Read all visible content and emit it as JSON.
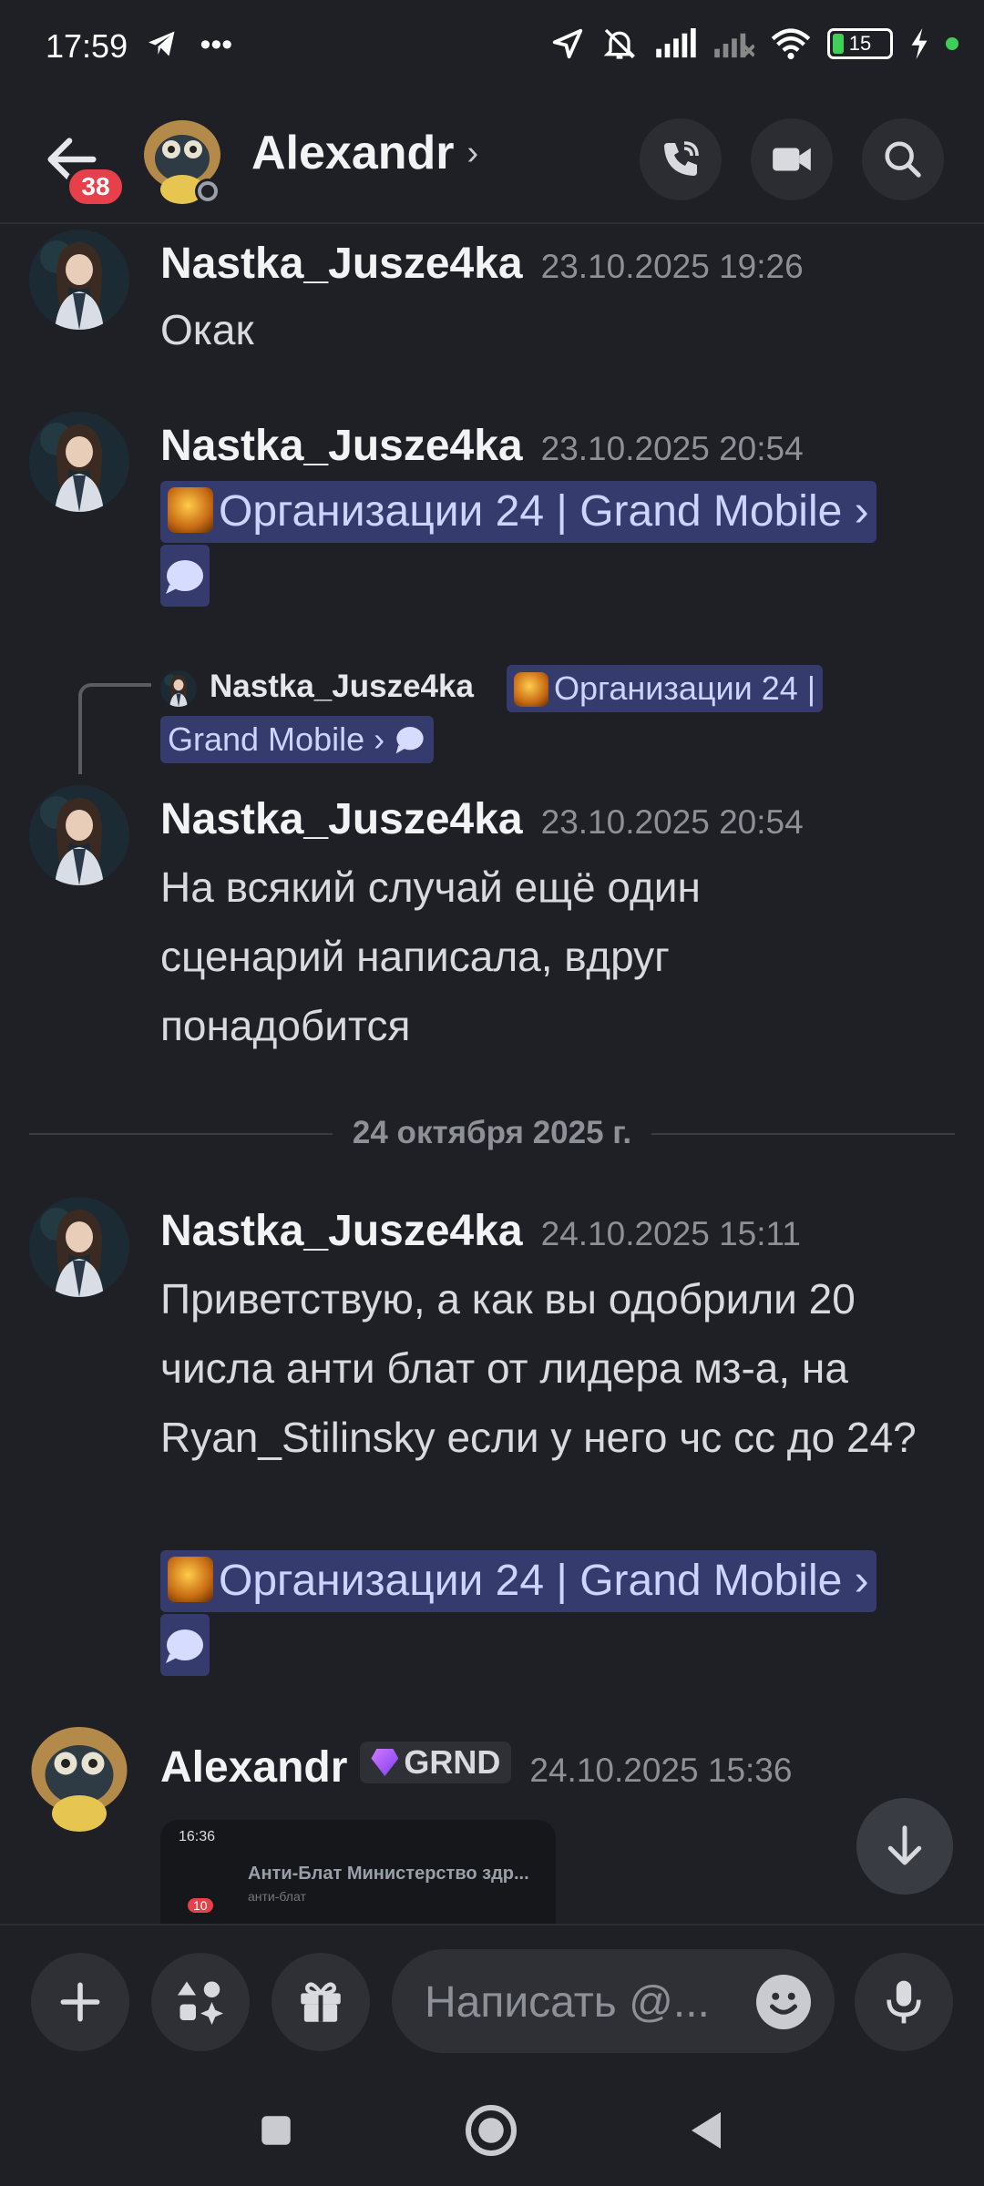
{
  "status_bar": {
    "time": "17:59",
    "left_icons": [
      "telegram-icon",
      "more-icon"
    ],
    "battery": "15",
    "right_icons": [
      "location-icon",
      "mute-icon",
      "signal-icon",
      "signal-2-icon",
      "wifi-icon",
      "battery-icon",
      "charging-icon"
    ]
  },
  "header": {
    "title": "Alexandr",
    "unread_badge": "38",
    "actions": [
      "call-icon",
      "video-icon",
      "search-icon"
    ]
  },
  "messages": [
    {
      "author": "Nastka_Jusze4ka",
      "timestamp": "23.10.2025 19:26",
      "text": "Окак"
    },
    {
      "author": "Nastka_Jusze4ka",
      "timestamp": "23.10.2025 20:54",
      "channel": "Организации 24 | Grand Mobile"
    },
    {
      "reply": {
        "author": "Nastka_Jusze4ka",
        "channel_part1": "Организации 24 |",
        "channel_part2": "Grand Mobile"
      },
      "author": "Nastka_Jusze4ka",
      "timestamp": "23.10.2025 20:54",
      "text": "На всякий случай ещё один сценарий написала, вдруг понадобится"
    },
    {
      "author": "Nastka_Jusze4ka",
      "timestamp": "24.10.2025 15:11",
      "text": "Приветствую, а как вы одобрили 20 числа анти блат от лидера мз-а, на Ryan_Stilinsky если у него чс сс до 24?",
      "channel": "Организации 24 | Grand Mobile"
    },
    {
      "author": "Alexandr",
      "role_tag": "GRND",
      "timestamp": "24.10.2025 15:36",
      "attachment": {
        "status_time": "16:36",
        "title": "Анти-Блат Министерство здр...",
        "subtitle": "анти-блат",
        "badge": "10"
      }
    }
  ],
  "date_divider": "24 октября 2025 г.",
  "composer": {
    "placeholder": "Написать @..."
  },
  "colors": {
    "background": "#1f2025",
    "channel_chip": "#363b6e",
    "badge_red": "#e8404a"
  }
}
